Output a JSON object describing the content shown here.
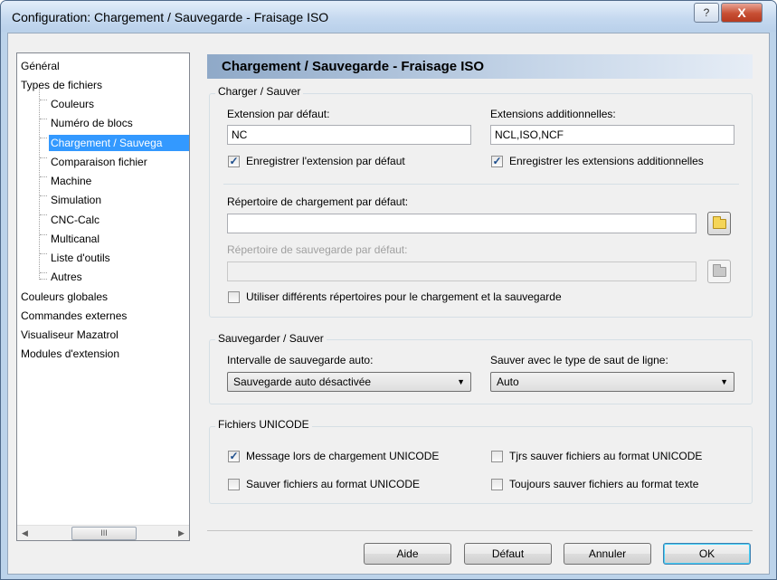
{
  "window": {
    "title": "Configuration: Chargement / Sauvegarde - Fraisage ISO",
    "help_label": "?",
    "close_label": "X"
  },
  "tree": {
    "items": [
      {
        "label": "Général"
      },
      {
        "label": "Types de fichiers"
      },
      {
        "label": "Couleurs"
      },
      {
        "label": "Numéro de blocs"
      },
      {
        "label": "Chargement / Sauvega"
      },
      {
        "label": "Comparaison fichier"
      },
      {
        "label": "Machine"
      },
      {
        "label": "Simulation"
      },
      {
        "label": "CNC-Calc"
      },
      {
        "label": "Multicanal"
      },
      {
        "label": "Liste d'outils"
      },
      {
        "label": "Autres"
      },
      {
        "label": "Couleurs globales"
      },
      {
        "label": "Commandes externes"
      },
      {
        "label": "Visualiseur Mazatrol"
      },
      {
        "label": "Modules d'extension"
      }
    ],
    "scroll_left": "◀",
    "scroll_right": "▶",
    "scroll_thumb": "III"
  },
  "header": {
    "title": "Chargement / Sauvegarde - Fraisage ISO"
  },
  "load_save": {
    "group_title": "Charger / Sauver",
    "default_ext_label": "Extension par défaut:",
    "default_ext_value": "NC",
    "additional_ext_label": "Extensions additionnelles:",
    "additional_ext_value": "NCL,ISO,NCF",
    "save_default_ext_label": "Enregistrer l'extension par défaut",
    "save_default_ext_checked": true,
    "save_additional_ext_label": "Enregistrer les extensions additionnelles",
    "save_additional_ext_checked": true,
    "load_dir_label": "Répertoire de chargement par défaut:",
    "load_dir_value": "",
    "save_dir_label": "Répertoire de sauvegarde par défaut:",
    "save_dir_value": "",
    "different_dirs_label": "Utiliser différents répertoires pour le chargement et la sauvegarde",
    "different_dirs_checked": false
  },
  "autosave": {
    "group_title": "Sauvegarder / Sauver",
    "interval_label": "Intervalle de sauvegarde auto:",
    "interval_value": "Sauvegarde auto désactivée",
    "linebreak_label": "Sauver avec le type de saut de ligne:",
    "linebreak_value": "Auto"
  },
  "unicode": {
    "group_title": "Fichiers UNICODE",
    "msg_on_load_label": "Message lors de chargement UNICODE",
    "msg_on_load_checked": true,
    "always_save_unicode_label": "Tjrs sauver fichiers au format UNICODE",
    "always_save_unicode_checked": false,
    "save_unicode_label": "Sauver fichiers au format UNICODE",
    "save_unicode_checked": false,
    "always_save_text_label": "Toujours sauver fichiers au format texte",
    "always_save_text_checked": false
  },
  "buttons": {
    "help": "Aide",
    "default": "Défaut",
    "cancel": "Annuler",
    "ok": "OK"
  },
  "check_glyph": "✓"
}
